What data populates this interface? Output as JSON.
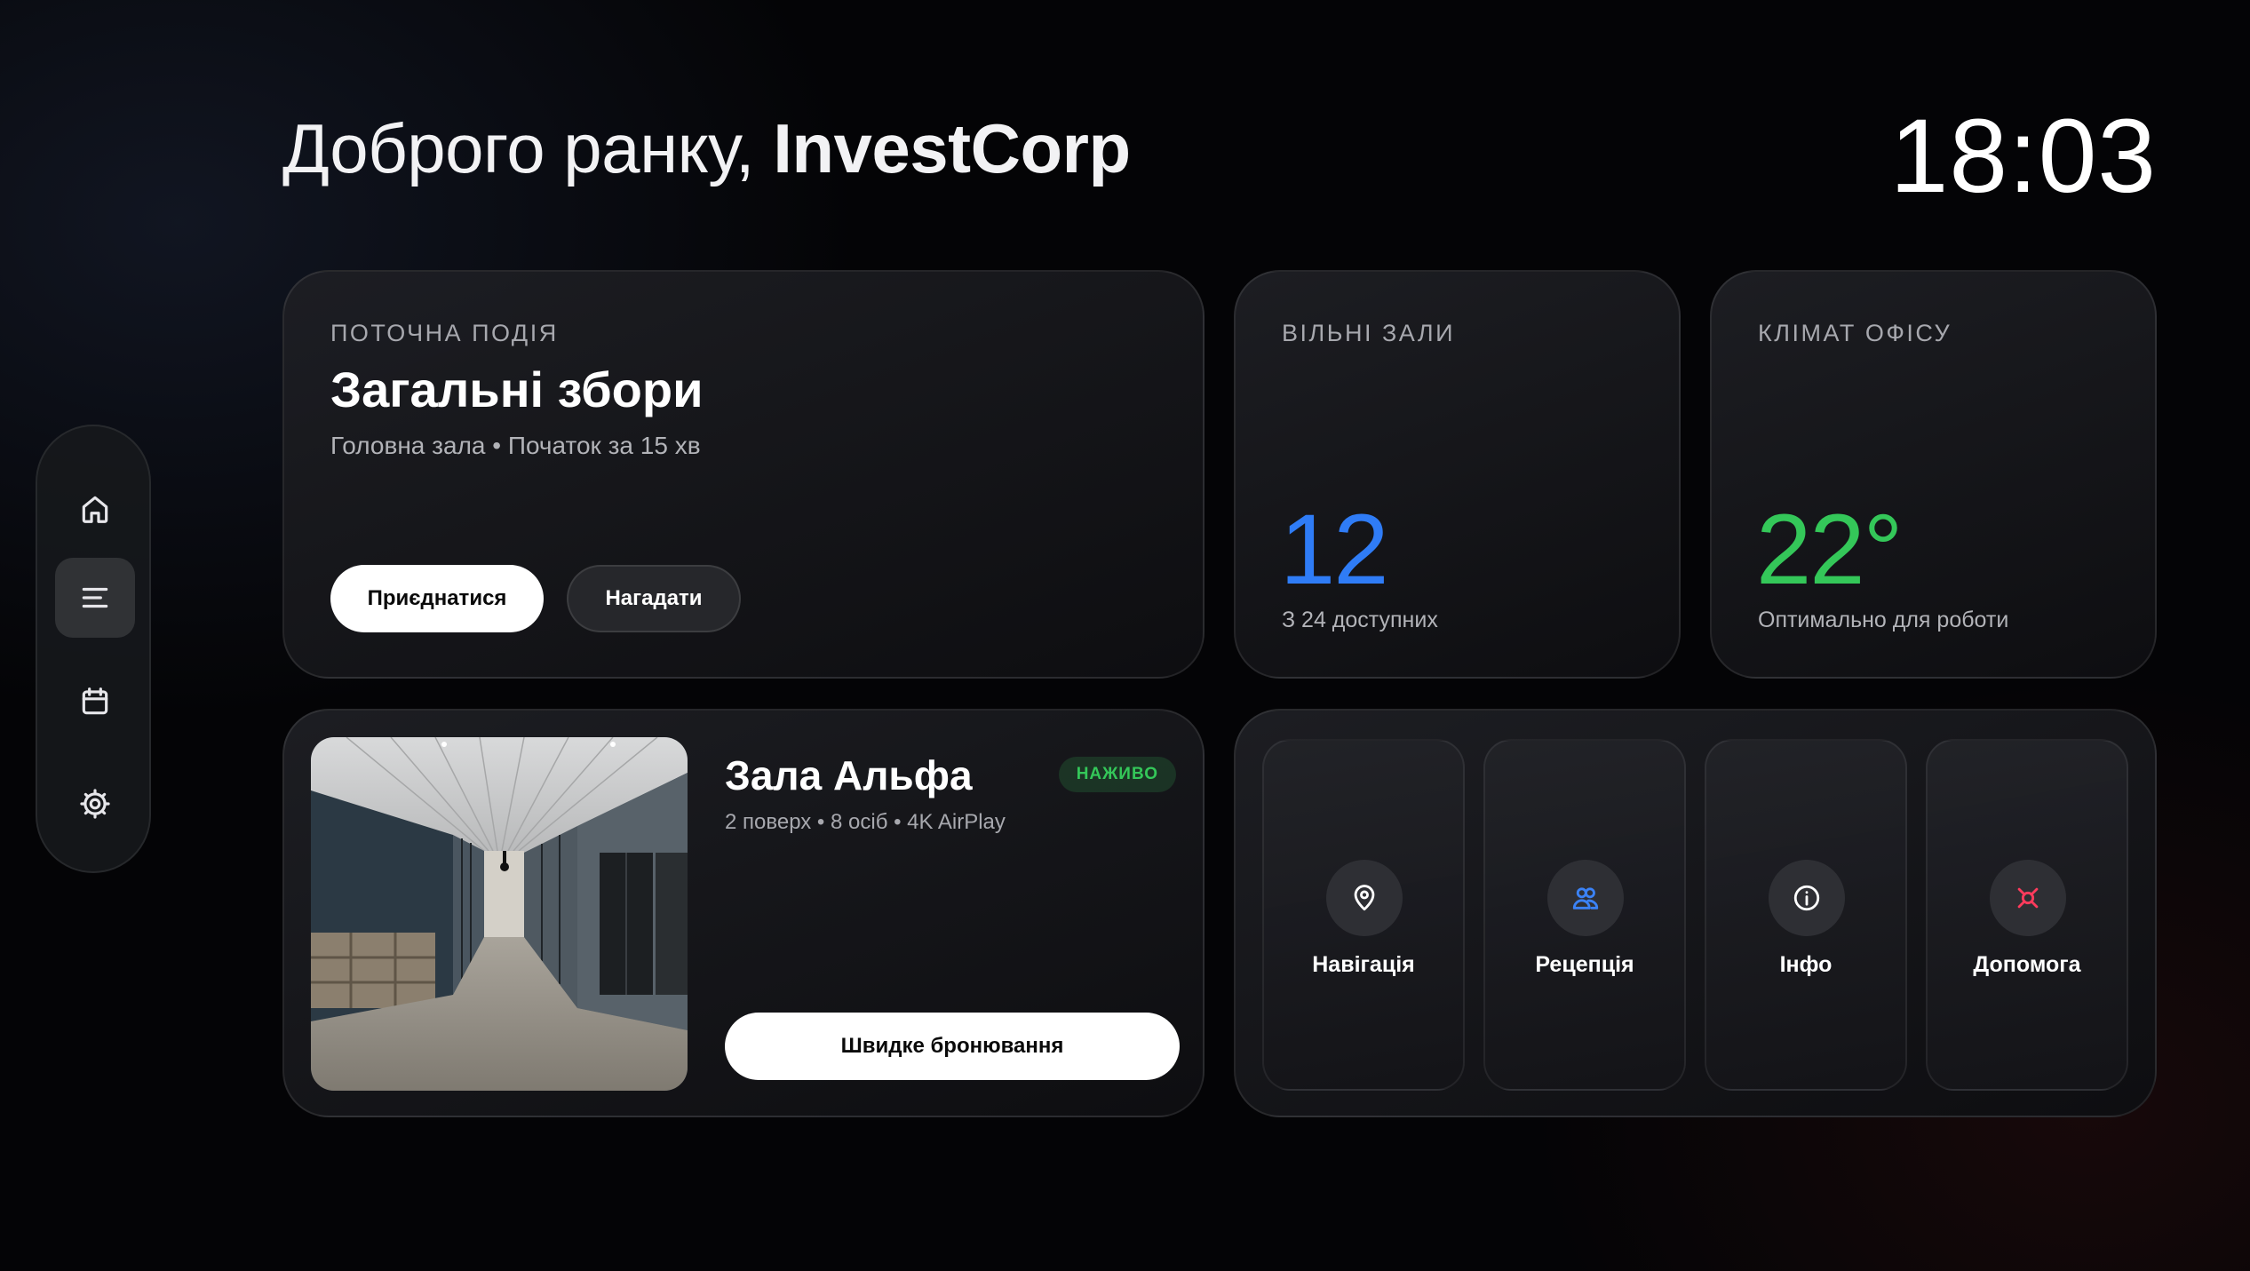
{
  "header": {
    "greeting_prefix": "Доброго ранку, ",
    "company": "InvestCorp",
    "time": "18:03"
  },
  "sidebar": {
    "items": [
      {
        "icon": "home-icon",
        "active": false
      },
      {
        "icon": "menu-icon",
        "active": true
      },
      {
        "icon": "calendar-icon",
        "active": false
      },
      {
        "icon": "gear-icon",
        "active": false
      }
    ]
  },
  "event": {
    "label": "ПОТОЧНА ПОДІЯ",
    "title": "Загальні збори",
    "subtitle": "Головна зала • Початок за 15 хв",
    "join_label": "Приєднатися",
    "remind_label": "Нагадати"
  },
  "rooms": {
    "label": "ВІЛЬНІ ЗАЛИ",
    "value": "12",
    "caption": "З 24 доступних",
    "color": "#2f7cf6"
  },
  "climate": {
    "label": "КЛІМАТ ОФІСУ",
    "value": "22°",
    "caption": "Оптимально для роботи",
    "color": "#34c759"
  },
  "room": {
    "name": "Зала Альфа",
    "meta": "2 поверх • 8 осіб • 4K AirPlay",
    "badge": "НАЖИВО",
    "book_label": "Швидке бронювання"
  },
  "actions": [
    {
      "label": "Навігація",
      "icon": "location-pin-icon",
      "color": "#ffffff"
    },
    {
      "label": "Рецепція",
      "icon": "users-icon",
      "color": "#3b82f6"
    },
    {
      "label": "Інфо",
      "icon": "info-icon",
      "color": "#ffffff"
    },
    {
      "label": "Допомога",
      "icon": "lifebuoy-icon",
      "color": "#ff3b5c"
    }
  ]
}
